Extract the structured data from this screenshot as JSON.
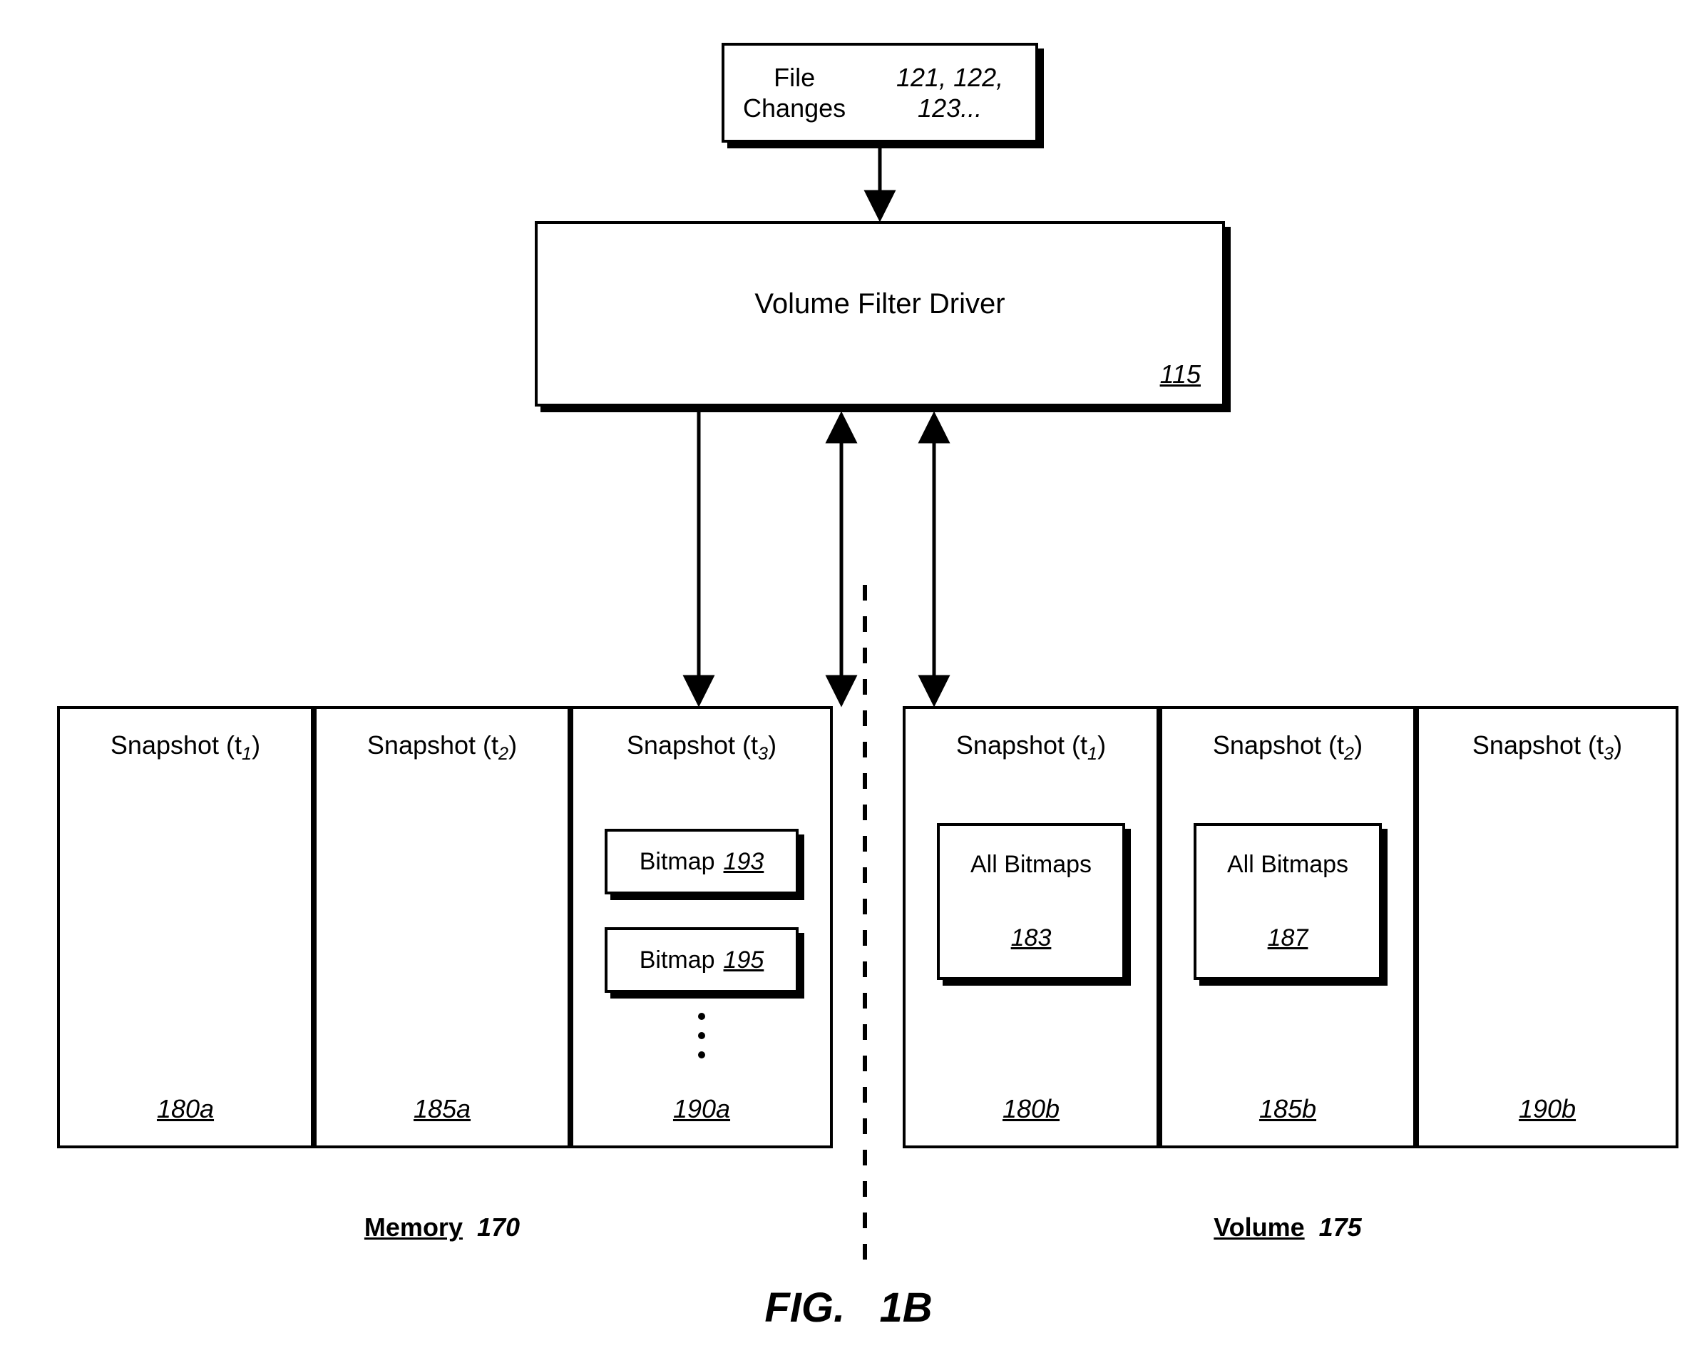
{
  "fileChanges": {
    "label1": "File",
    "label2": "Changes",
    "refs1": "121, 122,",
    "refs2": "123..."
  },
  "driver": {
    "title": "Volume Filter Driver",
    "ref": "115"
  },
  "memory": {
    "label": "Memory",
    "ref": "170",
    "snap1": {
      "title_pre": "Snapshot  (t",
      "title_sub": "1",
      "title_post": ")",
      "ref": "180a"
    },
    "snap2": {
      "title_pre": "Snapshot  (t",
      "title_sub": "2",
      "title_post": ")",
      "ref": "185a"
    },
    "snap3": {
      "title_pre": "Snapshot  (t",
      "title_sub": "3",
      "title_post": ")",
      "ref": "190a",
      "bitmap1": {
        "label": "Bitmap",
        "ref": "193"
      },
      "bitmap2": {
        "label": "Bitmap",
        "ref": "195"
      }
    }
  },
  "volume": {
    "label": "Volume",
    "ref": "175",
    "snap1": {
      "title_pre": "Snapshot  (t",
      "title_sub": "1",
      "title_post": ")",
      "ref": "180b",
      "bitmaps": {
        "label": "All Bitmaps",
        "ref": "183"
      }
    },
    "snap2": {
      "title_pre": "Snapshot  (t",
      "title_sub": "2",
      "title_post": ")",
      "ref": "185b",
      "bitmaps": {
        "label": "All Bitmaps",
        "ref": "187"
      }
    },
    "snap3": {
      "title_pre": "Snapshot  (t",
      "title_sub": "3",
      "title_post": ")",
      "ref": "190b"
    }
  },
  "figure": {
    "label_pre": "FIG.",
    "label_num": "1B"
  }
}
